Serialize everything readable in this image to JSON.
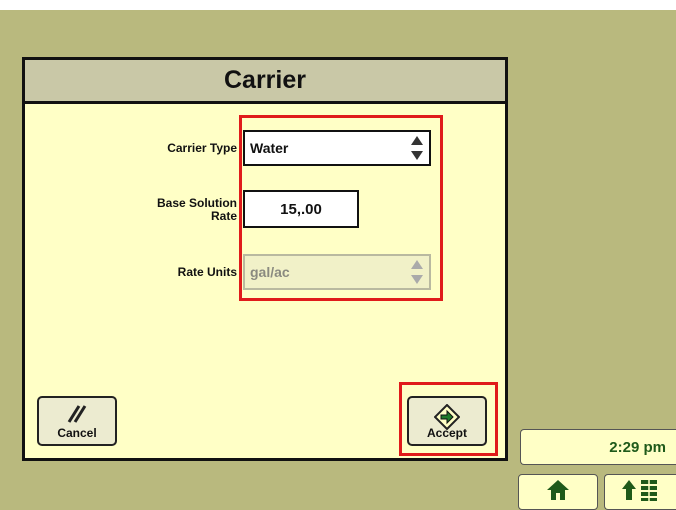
{
  "dialog": {
    "title": "Carrier",
    "fields": {
      "carrier_type": {
        "label": "Carrier Type",
        "value": "Water",
        "enabled": true
      },
      "base_solution_rate": {
        "label_line1": "Base Solution",
        "label_line2": "Rate",
        "value": "15,.00"
      },
      "rate_units": {
        "label": "Rate Units",
        "value": "gal/ac",
        "enabled": false
      }
    },
    "buttons": {
      "cancel_label": "Cancel",
      "accept_label": "Accept"
    }
  },
  "status_bar": {
    "time": "2:29 pm"
  },
  "icons": {
    "spinner": "up-down-arrows-icon",
    "cancel": "double-slash-icon",
    "accept": "arrow-diamond-icon",
    "home": "home-icon",
    "menu": "up-arrow-list-icon"
  },
  "colors": {
    "background": "#b9b97e",
    "dialog_body": "#ffffc6",
    "title_bar": "#c9c8a7",
    "highlight": "#e01b1b",
    "icon_green": "#1f5a1a"
  }
}
